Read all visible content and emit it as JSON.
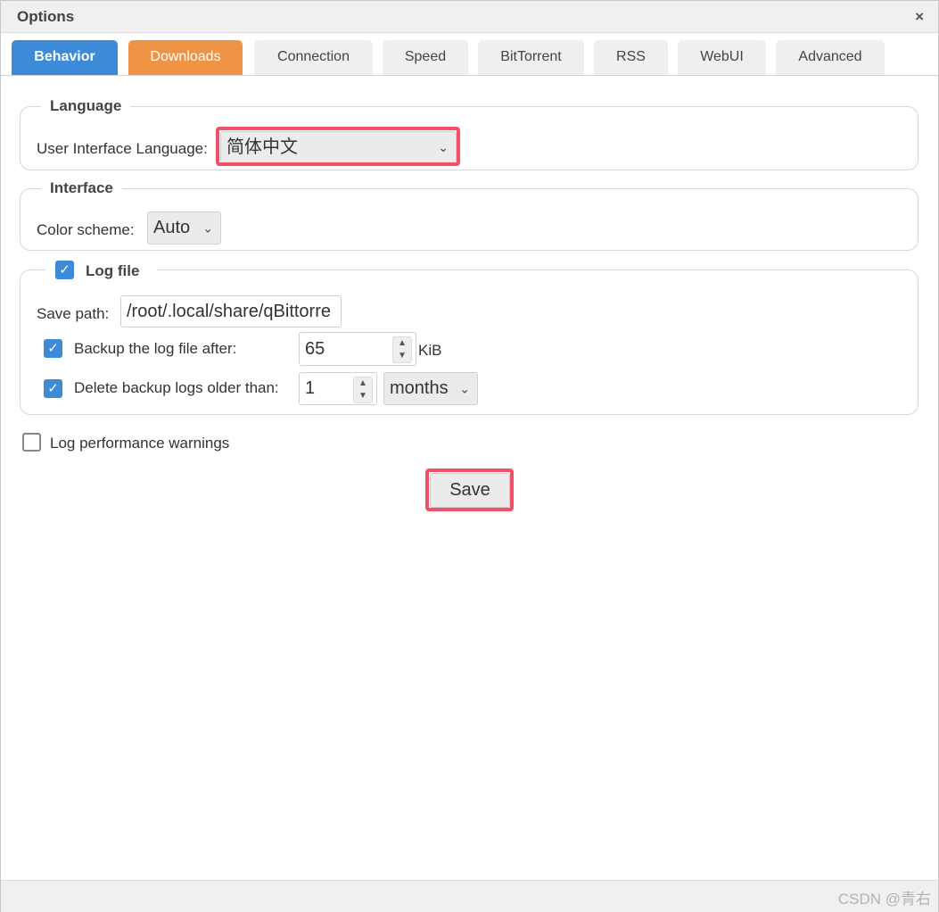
{
  "window": {
    "title": "Options",
    "close_glyph": "×"
  },
  "tabs": [
    {
      "label": "Behavior"
    },
    {
      "label": "Downloads"
    },
    {
      "label": "Connection"
    },
    {
      "label": "Speed"
    },
    {
      "label": "BitTorrent"
    },
    {
      "label": "RSS"
    },
    {
      "label": "WebUI"
    },
    {
      "label": "Advanced"
    }
  ],
  "language": {
    "legend": "Language",
    "ui_language_label": "User Interface Language:",
    "ui_language_value": "简体中文"
  },
  "interface": {
    "legend": "Interface",
    "color_scheme_label": "Color scheme:",
    "color_scheme_value": "Auto"
  },
  "log_file": {
    "legend": "Log file",
    "enabled": true,
    "save_path_label": "Save path:",
    "save_path_value": "/root/.local/share/qBittorre",
    "backup_label": "Backup the log file after:",
    "backup_checked": true,
    "backup_value": "65",
    "backup_unit": "KiB",
    "delete_label": "Delete backup logs older than:",
    "delete_checked": true,
    "delete_value": "1",
    "delete_unit": "months"
  },
  "perf_warnings": {
    "label": "Log performance warnings",
    "checked": false
  },
  "save_label": "Save",
  "watermark": "CSDN @青右",
  "icons": {
    "check": "✓",
    "chevron": "⌄",
    "spin_up": "▲",
    "spin_down": "▼"
  },
  "colors": {
    "behavior_tab": "#3c8ad8",
    "downloads_tab": "#ef9344",
    "highlight": "#f05169"
  }
}
